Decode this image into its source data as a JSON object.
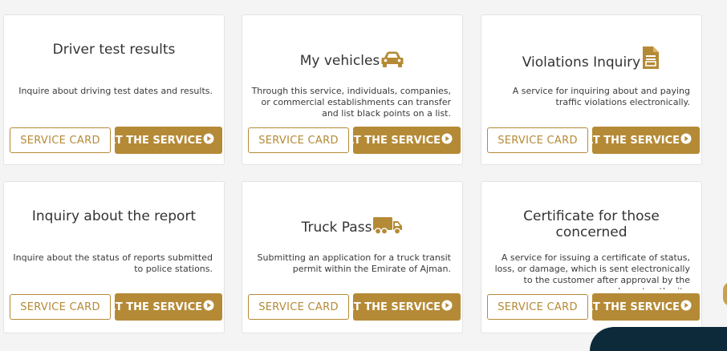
{
  "cards": [
    {
      "title": "Driver test results",
      "description": "Inquire about driving test dates and results.",
      "icon": "none",
      "service_card_label": "SERVICE CARD",
      "start_label": "ART THE SERVICE"
    },
    {
      "title": "My vehicles",
      "description": "Through this service, individuals, companies, or commercial establishments can transfer and list black points on a list.",
      "icon": "car-icon",
      "service_card_label": "SERVICE CARD",
      "start_label": "ART THE SERVICE"
    },
    {
      "title": "Violations Inquiry",
      "description": "A service for inquiring about and paying traffic violations electronically.",
      "icon": "document-icon",
      "service_card_label": "SERVICE CARD",
      "start_label": "ART THE SERVICE"
    },
    {
      "title": "Inquiry about the report",
      "description": "Inquire about the status of reports submitted to police stations.",
      "icon": "none",
      "service_card_label": "SERVICE CARD",
      "start_label": "ART THE SERVICE"
    },
    {
      "title": "Truck Pass",
      "description": "Submitting an application for a truck transit permit within the Emirate of Ajman.",
      "icon": "truck-icon",
      "service_card_label": "SERVICE CARD",
      "start_label": "ART THE SERVICE"
    },
    {
      "title": "Certificate for those concerned",
      "description": "A service for issuing a certificate of status, loss, or damage, which is sent electronically to the customer after approval by the relevant authority.",
      "icon": "none",
      "service_card_label": "SERVICE CARD",
      "start_label": "ART THE SERVICE"
    }
  ],
  "colors": {
    "accent": "#b58a36",
    "card_bg": "#ffffff",
    "page_bg": "#f4f4f4",
    "dark_navy": "#0d2a3a"
  }
}
